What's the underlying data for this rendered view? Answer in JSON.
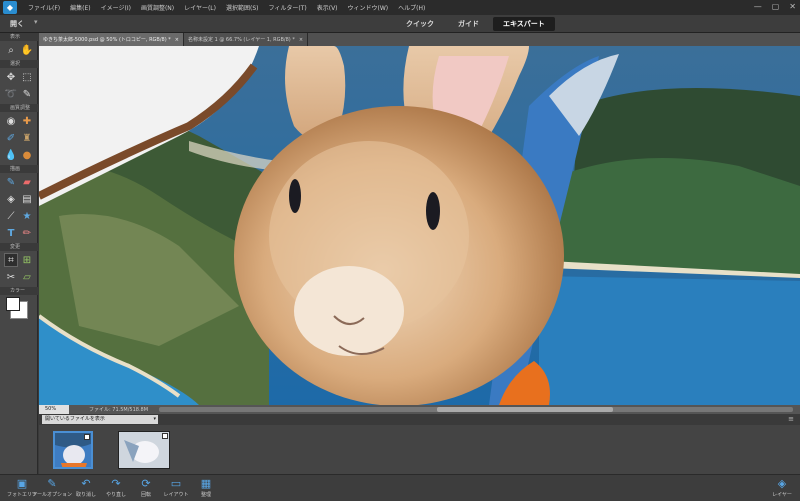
{
  "menubar": {
    "logo_text": "◆",
    "items": [
      "ファイル(F)",
      "編集(E)",
      "イメージ(I)",
      "画質調整(N)",
      "レイヤー(L)",
      "選択範囲(S)",
      "フィルター(T)",
      "表示(V)",
      "ウィンドウ(W)",
      "ヘルプ(H)"
    ],
    "minimize": "—",
    "maximize": "▢",
    "close": "✕"
  },
  "modebar": {
    "doc_label": "開く",
    "tabs": [
      "クイック",
      "ガイド",
      "エキスパート"
    ],
    "active_tab": "エキスパート"
  },
  "toolbox": {
    "sections": [
      "表示",
      "選択",
      "画質調整",
      "描画",
      "変更",
      "カラー"
    ]
  },
  "doc_tabs": [
    {
      "label": "ゆきち茶太郎-5000.psd @ 50% (トロコピー, RGB/8) *",
      "close": "×"
    },
    {
      "label": "名称未設定 1 @ 66.7% (レイヤー 1, RGB/8) *",
      "close": "×"
    }
  ],
  "status": {
    "zoom": "50%",
    "file_info": "ファイル: 71.5M/518.8M",
    "arrow": "▶"
  },
  "photo_bin": {
    "selector": "開いているファイルを表示",
    "caret": "▾",
    "menu_icon": "≡"
  },
  "taskbar": {
    "buttons": [
      {
        "label": "フォトエリア",
        "icon": "photo-bin-icon"
      },
      {
        "label": "ツールオプション",
        "icon": "tool-options-icon"
      },
      {
        "label": "取り消し",
        "icon": "undo-icon"
      },
      {
        "label": "やり直し",
        "icon": "redo-icon"
      },
      {
        "label": "回転",
        "icon": "rotate-icon"
      },
      {
        "label": "レイアウト",
        "icon": "layout-icon"
      },
      {
        "label": "整理",
        "icon": "organizer-icon"
      },
      {
        "label": "レイヤー",
        "icon": "layers-icon"
      }
    ]
  },
  "colors": {
    "accent": "#2a8dd0",
    "menubar": "#2b2b2b",
    "panel": "#474747"
  }
}
